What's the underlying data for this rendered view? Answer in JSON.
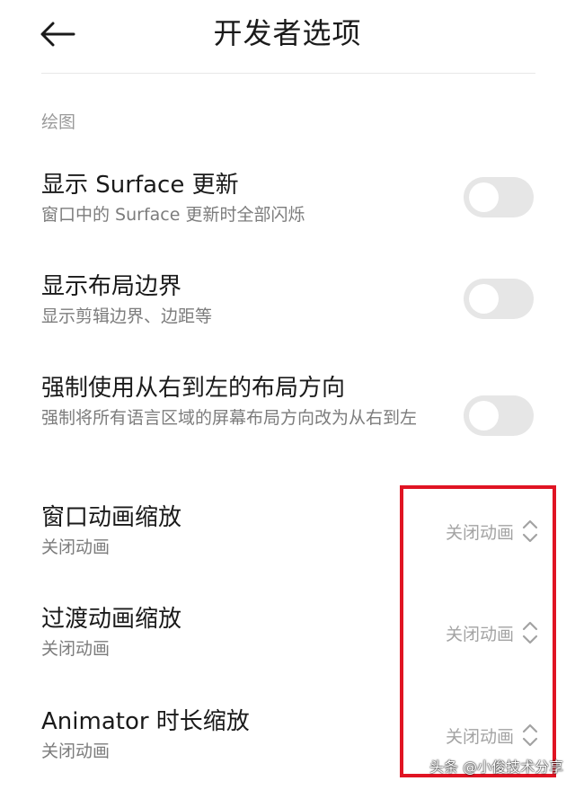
{
  "header": {
    "title": "开发者选项"
  },
  "section": {
    "label": "绘图"
  },
  "rows": [
    {
      "title": "显示 Surface 更新",
      "subtitle": "窗口中的 Surface 更新时全部闪烁",
      "toggle_on": false
    },
    {
      "title": "显示布局边界",
      "subtitle": "显示剪辑边界、边距等",
      "toggle_on": false
    },
    {
      "title": "强制使用从右到左的布局方向",
      "subtitle": "强制将所有语言区域的屏幕布局方向改为从右到左",
      "toggle_on": false
    },
    {
      "title": "窗口动画缩放",
      "subtitle": "关闭动画",
      "value": "关闭动画"
    },
    {
      "title": "过渡动画缩放",
      "subtitle": "关闭动画",
      "value": "关闭动画"
    },
    {
      "title": "Animator 时长缩放",
      "subtitle": "关闭动画",
      "value": "关闭动画"
    }
  ],
  "watermark": "头条 @小俊技术分享",
  "colors": {
    "highlight": "#e01423",
    "toggle_off": "#e6e6e6",
    "subtitle": "#7c7c7c",
    "section_label": "#9a9a9a"
  },
  "icons": {
    "back": "arrow-left-icon",
    "select": "chevron-up-down-icon"
  }
}
